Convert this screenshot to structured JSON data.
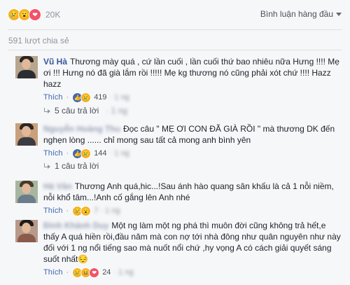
{
  "reactions": {
    "icons": [
      "sad-icon",
      "wow-icon",
      "love-icon"
    ],
    "count": "20K"
  },
  "sort_label": "Bình luận hàng đầu",
  "shares": "591 lượt chia sẻ",
  "comments": [
    {
      "author": "Vũ Hà",
      "text": "Thương mày quá , cứ lần cuối , lần cuối thứ bao nhiêu nữa Hưng !!!! Mẹ ơi !!! Hưng nó đã già lắm rồi !!!!! Mẹ kg thương nó cũng phải xót chứ !!!! Hazz hazz",
      "like_label": "Thích",
      "reaction_count": "419",
      "replies": "5 câu trả lời"
    },
    {
      "author": "Nguyễn Hoàng Thu",
      "text": "Đọc câu \" MẸ ƠI CON ĐÃ GIÀ RỒI \" mà thương DK đến nghẹn lòng ...... chỉ mong sau tất cả mong anh bình yên",
      "like_label": "Thích",
      "reaction_count": "144",
      "replies": "1 câu trả lời"
    },
    {
      "author": "Hà Văn",
      "text": "Thương Anh quá,hic...!Sau ánh hào quang sân khấu là cả 1 nỗi niềm, nỗi khổ tâm...!Anh cố gắng lên Anh nhé",
      "like_label": "Thích",
      "reaction_count": "",
      "replies": ""
    },
    {
      "author": "Đinh Khánh Duy",
      "text": "Một ng làm một ng phá thì muôn đời cũng không trả hết,e thấy A quá hiền rồi,đầu năm mà con nợ tới nhà đông như quân nguyên như này đối với 1 ng nổi tiếng sao mà nuốt nổi chứ ,hy vọng A có cách giải quyết sáng suốt nhất😔",
      "like_label": "Thích",
      "reaction_count": "24",
      "replies": ""
    }
  ]
}
